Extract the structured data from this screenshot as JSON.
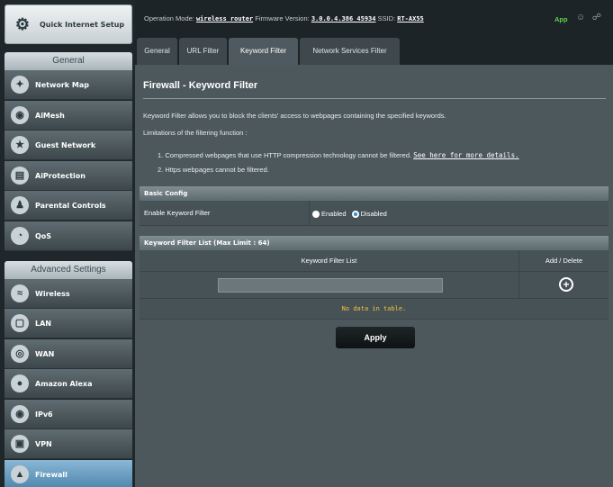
{
  "sidebar": {
    "quick_setup": "Quick Internet Setup",
    "general_header": "General",
    "general_items": [
      {
        "label": "Network Map",
        "icon": "network-map-icon"
      },
      {
        "label": "AiMesh",
        "icon": "aimesh-icon"
      },
      {
        "label": "Guest Network",
        "icon": "guest-network-icon"
      },
      {
        "label": "AiProtection",
        "icon": "aiprotection-icon"
      },
      {
        "label": "Parental Controls",
        "icon": "parental-controls-icon"
      },
      {
        "label": "QoS",
        "icon": "qos-icon"
      }
    ],
    "advanced_header": "Advanced Settings",
    "advanced_items": [
      {
        "label": "Wireless",
        "icon": "wireless-icon"
      },
      {
        "label": "LAN",
        "icon": "lan-icon"
      },
      {
        "label": "WAN",
        "icon": "wan-icon"
      },
      {
        "label": "Amazon Alexa",
        "icon": "alexa-icon"
      },
      {
        "label": "IPv6",
        "icon": "ipv6-icon"
      },
      {
        "label": "VPN",
        "icon": "vpn-icon"
      },
      {
        "label": "Firewall",
        "icon": "firewall-icon"
      }
    ]
  },
  "topbar": {
    "operation_mode_label": "Operation Mode:",
    "operation_mode": "wireless router",
    "firmware_label": "Firmware Version:",
    "firmware": "3.0.0.4.386_45934",
    "ssid_label": "SSID:",
    "ssid": "RT-AX55",
    "app_label": "App"
  },
  "tabs": [
    "General",
    "URL Filter",
    "Keyword Filter",
    "Network Services Filter"
  ],
  "main": {
    "title": "Firewall - Keyword Filter",
    "description": "Keyword Filter allows you to block the clients' access to webpages containing the specified keywords.",
    "limitations_label": "Limitations of the filtering function :",
    "limitation_1": "1. Compressed webpages that use HTTP compression technology cannot be filtered.",
    "see_here_link": "See here for more details.",
    "limitation_2": "2. Https webpages cannot be filtered.",
    "basic_config_header": "Basic Config",
    "enable_label": "Enable Keyword Filter",
    "enabled_option": "Enabled",
    "disabled_option": "Disabled",
    "list_header": "Keyword Filter List (Max Limit : 64)",
    "col_keyword": "Keyword Filter List",
    "col_add_delete": "Add / Delete",
    "keyword_input_value": "",
    "no_data": "No data in table.",
    "apply_label": "Apply"
  }
}
